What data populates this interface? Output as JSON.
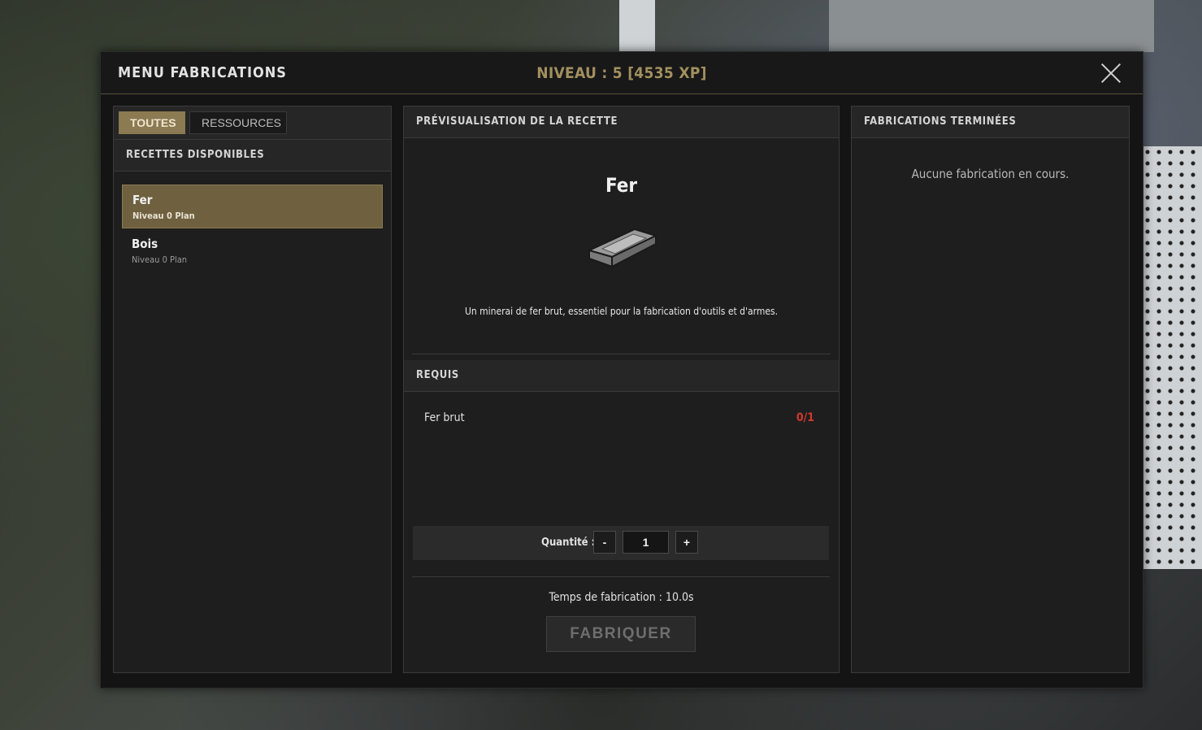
{
  "header": {
    "title": "MENU FABRICATIONS",
    "level": "NIVEAU : 5 [4535 XP]"
  },
  "left": {
    "tabs": [
      {
        "label": "TOUTES",
        "active": true
      },
      {
        "label": "RESSOURCES",
        "active": false
      }
    ],
    "section_title": "RECETTES DISPONIBLES",
    "recipes": [
      {
        "name": "Fer",
        "sub": "Niveau 0 Plan",
        "selected": true
      },
      {
        "name": "Bois",
        "sub": "Niveau 0 Plan",
        "selected": false
      }
    ]
  },
  "middle": {
    "section_title": "PRÉVISUALISATION DE LA RECETTE",
    "item_name": "Fer",
    "item_icon": "iron-ingot-icon",
    "item_description": "Un minerai de fer brut, essentiel pour la fabrication d'outils et d'armes.",
    "requirements_title": "REQUIS",
    "requirements": [
      {
        "name": "Fer brut",
        "count": "0/1"
      }
    ],
    "quantity_label": "Quantité :",
    "quantity_minus": "-",
    "quantity_plus": "+",
    "quantity_value": "1",
    "craft_time": "Temps de fabrication : 10.0s",
    "craft_button": "FABRIQUER"
  },
  "right": {
    "section_title": "FABRICATIONS TERMINÉES",
    "empty_message": "Aucune fabrication en cours."
  },
  "colors": {
    "accent": "#8b7a52",
    "level_text": "#a3905f",
    "missing_count": "#d0392c"
  }
}
